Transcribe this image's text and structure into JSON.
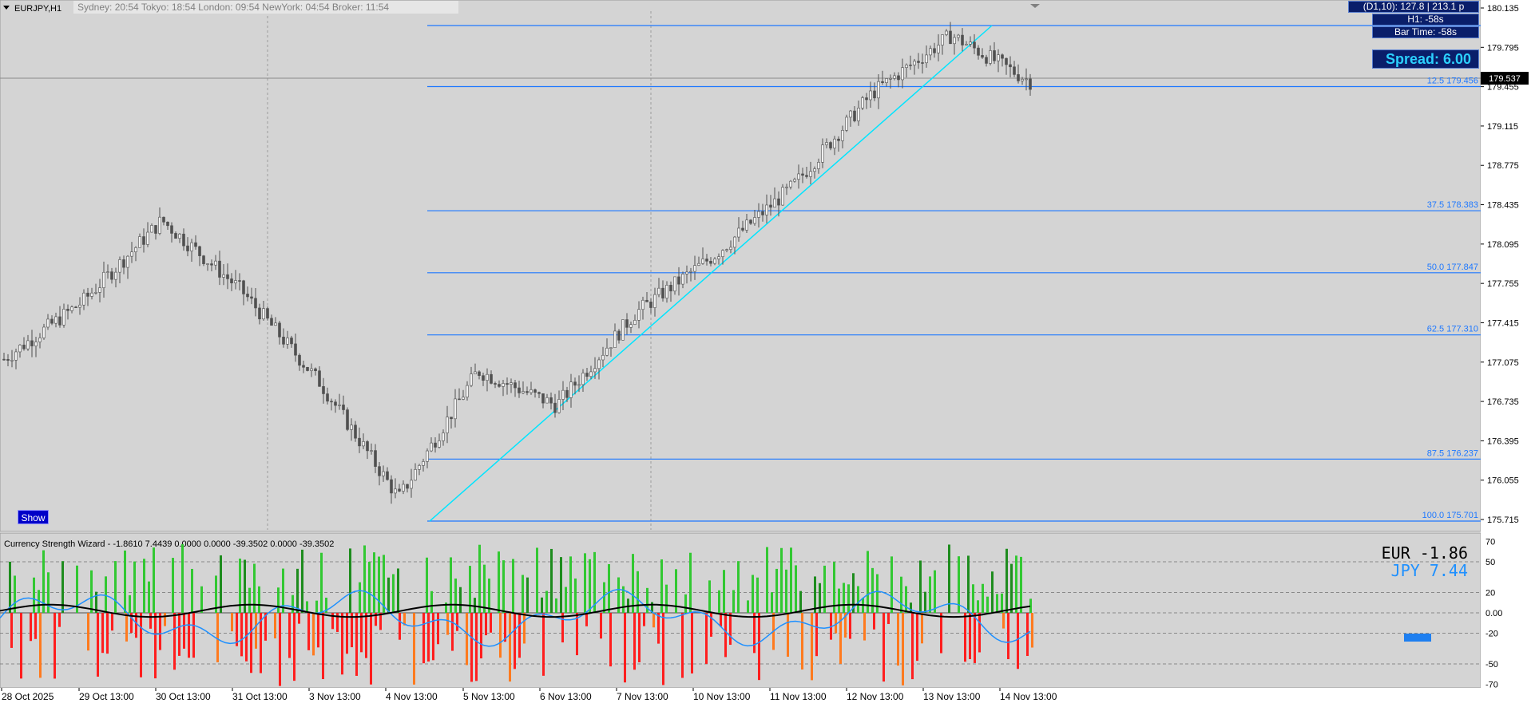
{
  "header": {
    "symbol": "EURJPY,H1",
    "sessions": "Sydney: 20:54   Tokyo: 18:54   London: 09:54   NewYork: 04:54   Broker: 11:54"
  },
  "info_panel": {
    "adr": "(D1,10): 127.8  |  213.1 p",
    "h1_timer": "H1: -58s",
    "bar_time": "Bar Time: -58s",
    "spread": "Spread: 6.00"
  },
  "price_axis": {
    "labels": [
      "180.135",
      "179.795",
      "179.455",
      "179.115",
      "178.775",
      "178.435",
      "178.095",
      "177.755",
      "177.415",
      "177.075",
      "176.735",
      "176.395",
      "176.055",
      "175.715"
    ],
    "current_price": "179.537"
  },
  "fibonacci": {
    "levels": [
      {
        "label": "12.5  179.456",
        "price": 179.456
      },
      {
        "label": "37.5  178.383",
        "price": 178.383
      },
      {
        "label": "50.0  177.847",
        "price": 177.847
      },
      {
        "label": "62.5  177.310",
        "price": 177.31
      },
      {
        "label": "87.5  176.237",
        "price": 176.237
      },
      {
        "label": "100.0  175.701",
        "price": 175.701
      }
    ],
    "top_price": 180.0
  },
  "show_button": "Show",
  "indicator": {
    "title": "Currency Strength Wizard -  -1.8610 7.4439 0.0000 0.0000 -39.3502 0.0000 -39.3502",
    "eur_label": "EUR -1.86",
    "jpy_label": "JPY 7.44",
    "axis_labels": [
      "70",
      "50",
      "20",
      "0.00",
      "-20",
      "-50",
      "-70"
    ],
    "colors": {
      "eur": "#000000",
      "jpy": "#1e90ff",
      "positive": "#32c832",
      "negative": "#ff1e1e"
    }
  },
  "time_axis": {
    "labels": [
      "28 Oct 2025",
      "29 Oct 13:00",
      "30 Oct 13:00",
      "31 Oct 13:00",
      "3 Nov 13:00",
      "4 Nov 13:00",
      "5 Nov 13:00",
      "6 Nov 13:00",
      "7 Nov 13:00",
      "10 Nov 13:00",
      "11 Nov 13:00",
      "12 Nov 13:00",
      "13 Nov 13:00",
      "14 Nov 13:00"
    ]
  },
  "chart_data": {
    "type": "line",
    "title": "EURJPY,H1",
    "approx_price_path": [
      {
        "x": "28 Oct 2025",
        "y": 177.1
      },
      {
        "x": "29 Oct 13:00",
        "y": 177.6
      },
      {
        "x": "30 Oct 13:00",
        "y": 178.3
      },
      {
        "x": "31 Oct 13:00",
        "y": 177.7
      },
      {
        "x": "3 Nov 13:00",
        "y": 176.9
      },
      {
        "x": "4 Nov 13:00",
        "y": 175.9
      },
      {
        "x": "5 Nov 13:00",
        "y": 177.0
      },
      {
        "x": "6 Nov 13:00",
        "y": 176.7
      },
      {
        "x": "7 Nov 13:00",
        "y": 177.5
      },
      {
        "x": "10 Nov 13:00",
        "y": 178.0
      },
      {
        "x": "11 Nov 13:00",
        "y": 178.6
      },
      {
        "x": "12 Nov 13:00",
        "y": 179.4
      },
      {
        "x": "13 Nov 13:00",
        "y": 179.9
      },
      {
        "x": "14 Nov 13:00",
        "y": 179.5
      }
    ],
    "ylim": [
      175.715,
      180.135
    ],
    "grid": true
  }
}
